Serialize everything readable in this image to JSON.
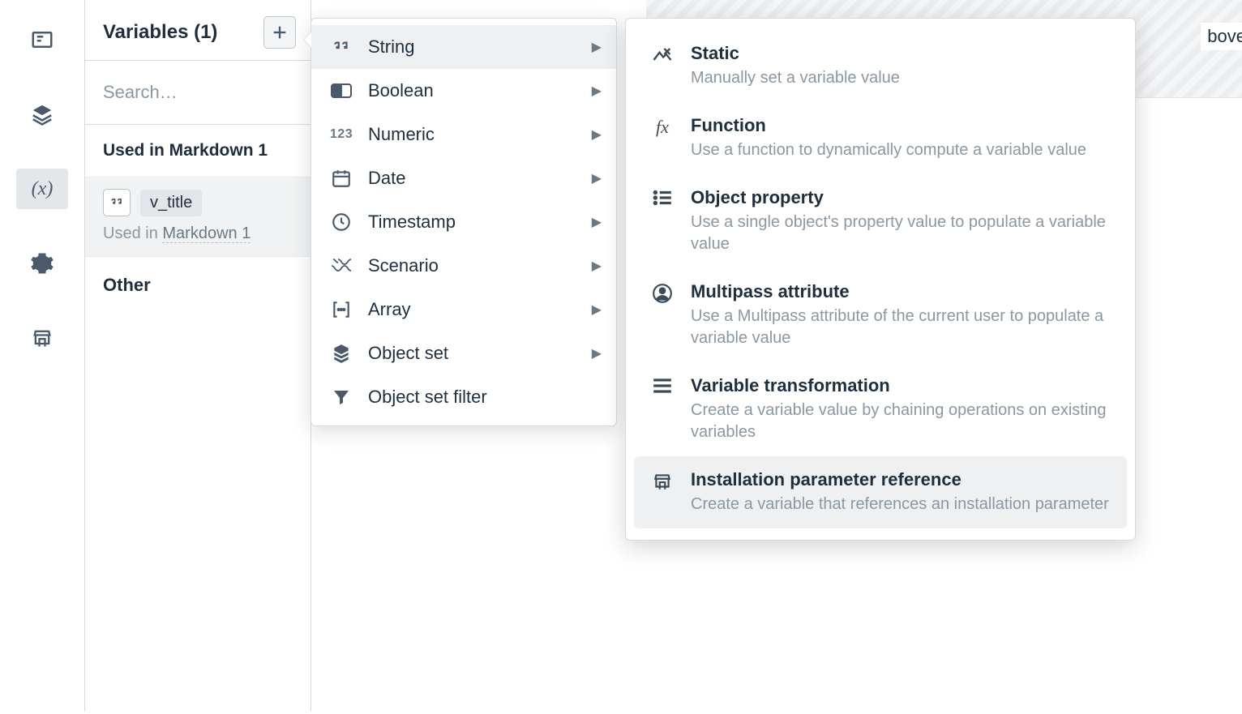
{
  "panel": {
    "title": "Variables (1)",
    "search_placeholder": "Search…",
    "section_label": "Used in Markdown 1",
    "other_label": "Other"
  },
  "variable": {
    "name": "v_title",
    "used_in_prefix": "Used in ",
    "used_in_link": "Markdown 1"
  },
  "types": [
    {
      "icon": "quotes",
      "label": "String",
      "has_children": true,
      "hover": true
    },
    {
      "icon": "boolean",
      "label": "Boolean",
      "has_children": true
    },
    {
      "icon": "numeric",
      "label": "Numeric",
      "has_children": true
    },
    {
      "icon": "date",
      "label": "Date",
      "has_children": true
    },
    {
      "icon": "timestamp",
      "label": "Timestamp",
      "has_children": true
    },
    {
      "icon": "scenario",
      "label": "Scenario",
      "has_children": true
    },
    {
      "icon": "array",
      "label": "Array",
      "has_children": true
    },
    {
      "icon": "objectset",
      "label": "Object set",
      "has_children": true
    },
    {
      "icon": "filter",
      "label": "Object set filter",
      "has_children": false
    }
  ],
  "subs": [
    {
      "icon": "static",
      "title": "Static",
      "desc": "Manually set a variable value"
    },
    {
      "icon": "function",
      "title": "Function",
      "desc": "Use a function to dynamically compute a variable value"
    },
    {
      "icon": "objprop",
      "title": "Object property",
      "desc": "Use a single object's property value to populate a variable value"
    },
    {
      "icon": "multipass",
      "title": "Multipass attribute",
      "desc": "Use a Multipass attribute of the current user to populate a variable value"
    },
    {
      "icon": "transform",
      "title": "Variable transformation",
      "desc": "Create a variable value by chaining operations on existing variables"
    },
    {
      "icon": "install",
      "title": "Installation parameter reference",
      "desc": "Create a variable that references an installation parameter",
      "hover": true
    }
  ],
  "right_partial_text": "bove"
}
